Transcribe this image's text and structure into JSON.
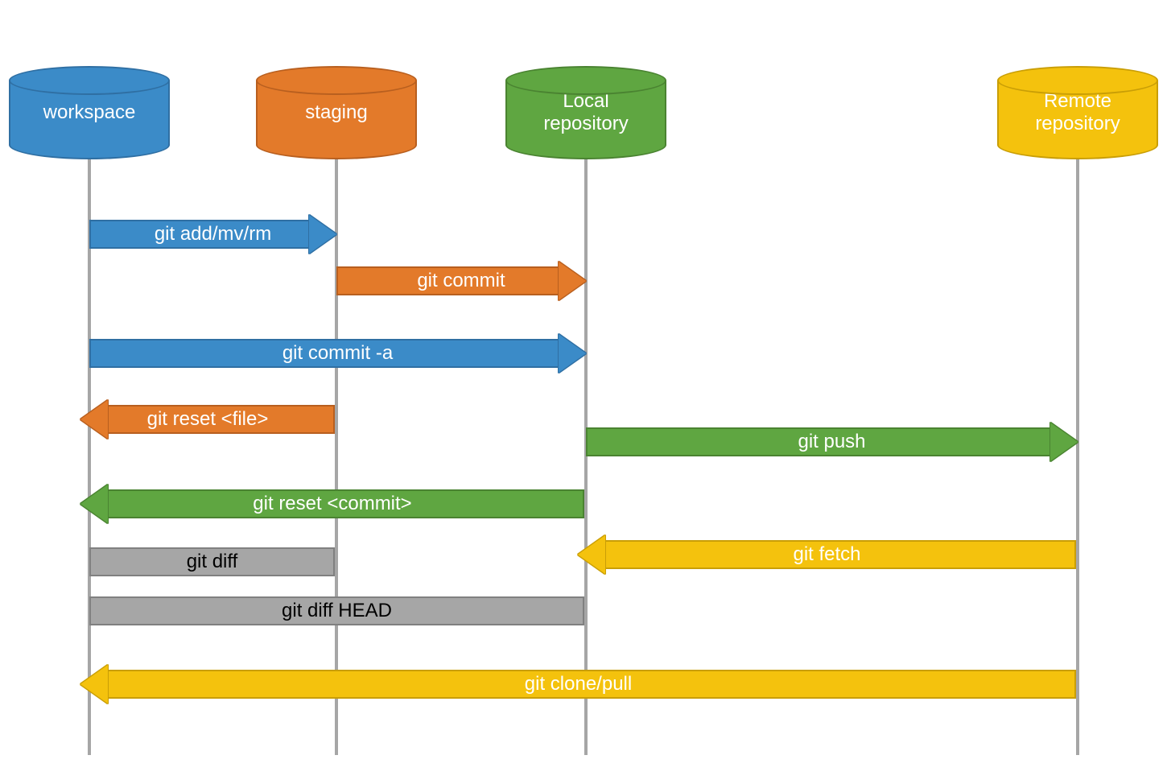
{
  "nodes": {
    "workspace": "workspace",
    "staging": "staging",
    "local": "Local\nrepository",
    "remote": "Remote\nrepository"
  },
  "commands": {
    "add": "git add/mv/rm",
    "commit": "git commit",
    "commit_a": "git commit -a",
    "reset_file": "git reset <file>",
    "push": "git push",
    "reset_commit": "git reset <commit>",
    "fetch": "git fetch",
    "diff": "git diff",
    "diff_head": "git diff HEAD",
    "clone_pull": "git clone/pull"
  },
  "colors": {
    "blue": "#3b8bc8",
    "orange": "#e37a2a",
    "green": "#5fa641",
    "yellow": "#f4c20d",
    "gray": "#a6a6a6"
  },
  "chart_data": {
    "type": "sequence-diagram",
    "lanes": [
      {
        "id": "workspace",
        "label": "workspace",
        "color": "blue"
      },
      {
        "id": "staging",
        "label": "staging",
        "color": "orange"
      },
      {
        "id": "local",
        "label": "Local repository",
        "color": "green"
      },
      {
        "id": "remote",
        "label": "Remote repository",
        "color": "yellow"
      }
    ],
    "arrows": [
      {
        "label": "git add/mv/rm",
        "from": "workspace",
        "to": "staging",
        "direction": "right",
        "color": "blue"
      },
      {
        "label": "git commit",
        "from": "staging",
        "to": "local",
        "direction": "right",
        "color": "orange"
      },
      {
        "label": "git commit -a",
        "from": "workspace",
        "to": "local",
        "direction": "right",
        "color": "blue"
      },
      {
        "label": "git reset <file>",
        "from": "staging",
        "to": "workspace",
        "direction": "left",
        "color": "orange"
      },
      {
        "label": "git push",
        "from": "local",
        "to": "remote",
        "direction": "right",
        "color": "green"
      },
      {
        "label": "git reset <commit>",
        "from": "local",
        "to": "workspace",
        "direction": "left",
        "color": "green"
      },
      {
        "label": "git fetch",
        "from": "remote",
        "to": "local",
        "direction": "left",
        "color": "yellow"
      },
      {
        "label": "git diff",
        "from": "workspace",
        "to": "staging",
        "direction": "none",
        "color": "gray"
      },
      {
        "label": "git diff HEAD",
        "from": "workspace",
        "to": "local",
        "direction": "none",
        "color": "gray"
      },
      {
        "label": "git clone/pull",
        "from": "remote",
        "to": "workspace",
        "direction": "left",
        "color": "yellow"
      }
    ]
  }
}
